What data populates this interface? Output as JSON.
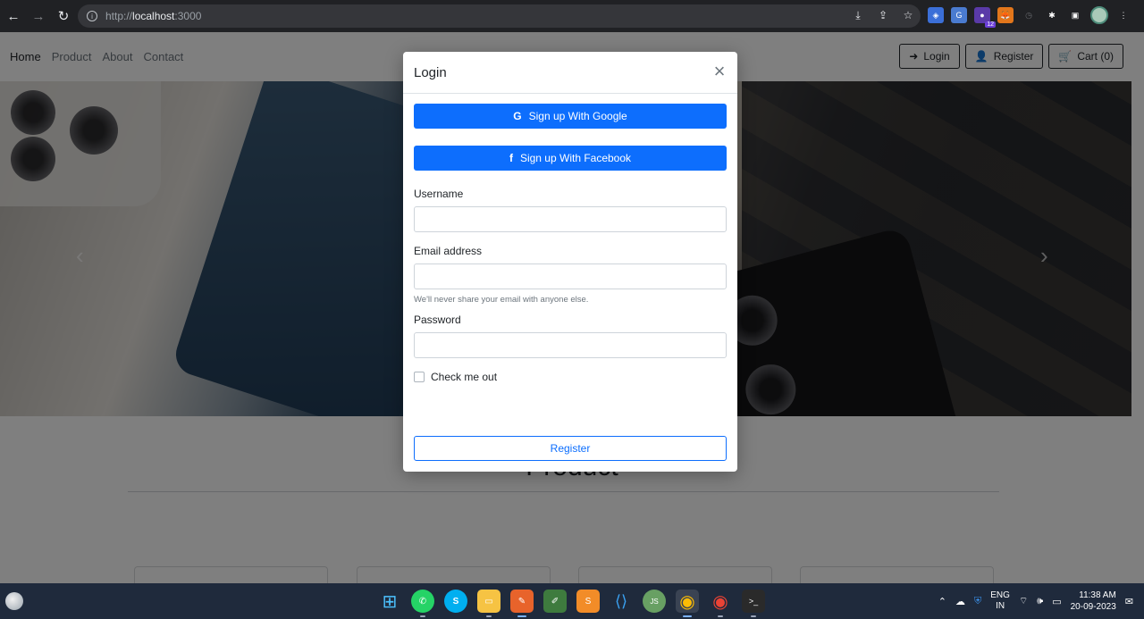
{
  "browser": {
    "url_prefix": "http://",
    "url_host": "localhost",
    "url_port": ":3000",
    "extension_badge": "12"
  },
  "navbar": {
    "links": [
      "Home",
      "Product",
      "About",
      "Contact"
    ],
    "login_label": "Login",
    "register_label": "Register",
    "cart_label": "Cart (0)"
  },
  "hero": {
    "prev_arrow": "‹",
    "next_arrow": "›"
  },
  "section": {
    "title": "Product"
  },
  "modal": {
    "title": "Login",
    "close": "×",
    "google_label": "Sign up With Google",
    "facebook_label": "Sign up With Facebook",
    "username_label": "Username",
    "email_label": "Email address",
    "email_help": "We'll never share your email with anyone else.",
    "password_label": "Password",
    "check_label": "Check me out",
    "submit_label": "Register"
  },
  "taskbar": {
    "lang_line1": "ENG",
    "lang_line2": "IN",
    "time": "11:38 AM",
    "date": "20-09-2023"
  },
  "colors": {
    "primary": "#0d6efd",
    "chrome_bg": "#202124",
    "taskbar_bg": "#1f2a3c"
  }
}
